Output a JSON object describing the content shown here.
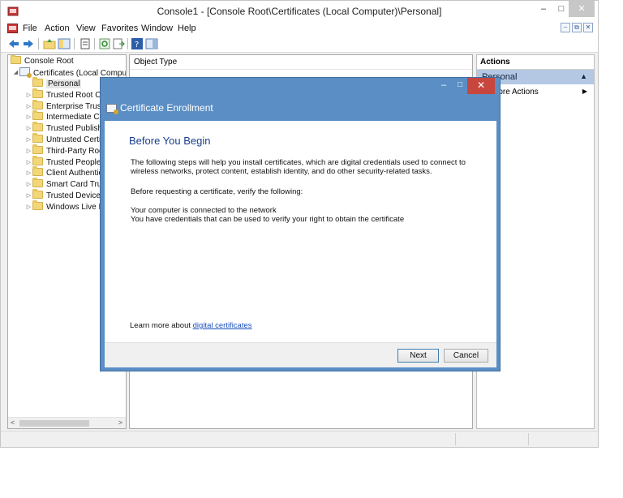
{
  "window": {
    "title": "Console1 - [Console Root\\Certificates (Local Computer)\\Personal]",
    "minimize": "–",
    "maximize": "□",
    "close": "✕"
  },
  "menu": [
    "File",
    "Action",
    "View",
    "Favorites",
    "Window",
    "Help"
  ],
  "mdi_buttons": [
    "–",
    "⧉",
    "✕"
  ],
  "tree": {
    "root": "Console Root",
    "certificates": "Certificates (Local Compute",
    "items": [
      {
        "label": "Personal",
        "selected": true
      },
      {
        "label": "Trusted Root Cer"
      },
      {
        "label": "Enterprise Trust"
      },
      {
        "label": "Intermediate Cer"
      },
      {
        "label": "Trusted Publishe"
      },
      {
        "label": "Untrusted Certifi"
      },
      {
        "label": "Third-Party Root"
      },
      {
        "label": "Trusted People"
      },
      {
        "label": "Client Authentic"
      },
      {
        "label": "Smart Card Trust"
      },
      {
        "label": "Trusted Devices"
      },
      {
        "label": "Windows Live ID"
      }
    ]
  },
  "content": {
    "column_header": "Object Type"
  },
  "actions": {
    "title": "Actions",
    "section": "Personal",
    "more_actions": "More Actions"
  },
  "dialog": {
    "title": "Certificate Enrollment",
    "heading": "Before You Begin",
    "paragraph": "The following steps will help you install certificates, which are digital credentials used to connect to wireless networks, protect content, establish identity, and do other security-related tasks.",
    "verify_intro": "Before requesting a certificate, verify the following:",
    "checklist": [
      "Your computer is connected to the network",
      "You have credentials that can be used to verify your right to obtain the certificate"
    ],
    "learn_more": "Learn more about",
    "learn_more_link": "digital certificates",
    "next": "Next",
    "cancel": "Cancel",
    "minimize": "–",
    "maximize": "□",
    "close": "✕"
  },
  "colors": {
    "dialog_frame": "#5b8ec4",
    "close_red": "#c7463d",
    "actions_highlight": "#b4c8e4",
    "link": "#1a4fbf"
  }
}
